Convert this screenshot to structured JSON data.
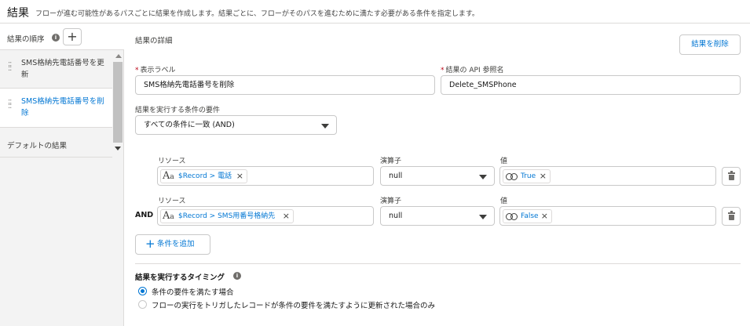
{
  "header": {
    "title": "結果",
    "description": "フローが進む可能性があるパスごとに結果を作成します。結果ごとに、フローがそのパスを進むために満たす必要がある条件を指定します。"
  },
  "sidebar": {
    "order_label": "結果の順序",
    "add_symbol": "+",
    "items": [
      {
        "label": "SMS格納先電話番号を更新"
      },
      {
        "label": "SMS格納先電話番号を削除"
      }
    ],
    "default_label": "デフォルトの結果"
  },
  "details": {
    "section_title": "結果の詳細",
    "delete_button": "結果を削除",
    "label_field": {
      "label": "表示ラベル",
      "value": "SMS格納先電話番号を削除"
    },
    "api_field": {
      "label": "結果の API 参照名",
      "value": "Delete_SMSPhone"
    },
    "requirement": {
      "label": "結果を実行する条件の要件",
      "value": "すべての条件に一致 (AND)"
    }
  },
  "conditions": {
    "resource_label": "リソース",
    "operator_label": "演算子",
    "value_label": "値",
    "and_label": "AND",
    "rows": [
      {
        "resource": "$Record > 電話",
        "operator": "null",
        "value": "True"
      },
      {
        "resource": "$Record > SMS用番号格納先",
        "operator": "null",
        "value": "False"
      }
    ],
    "add_button": "条件を追加"
  },
  "timing": {
    "title": "結果を実行するタイミング",
    "options": [
      {
        "label": "条件の要件を満たす場合",
        "selected": true
      },
      {
        "label": "フローの実行をトリガしたレコードが条件の要件を満たすように更新された場合のみ",
        "selected": false
      }
    ]
  },
  "colors": {
    "accent": "#0176d3",
    "border": "#c9c9c9",
    "sidebar_bg": "#f3f3f3",
    "required": "#ba0517"
  }
}
